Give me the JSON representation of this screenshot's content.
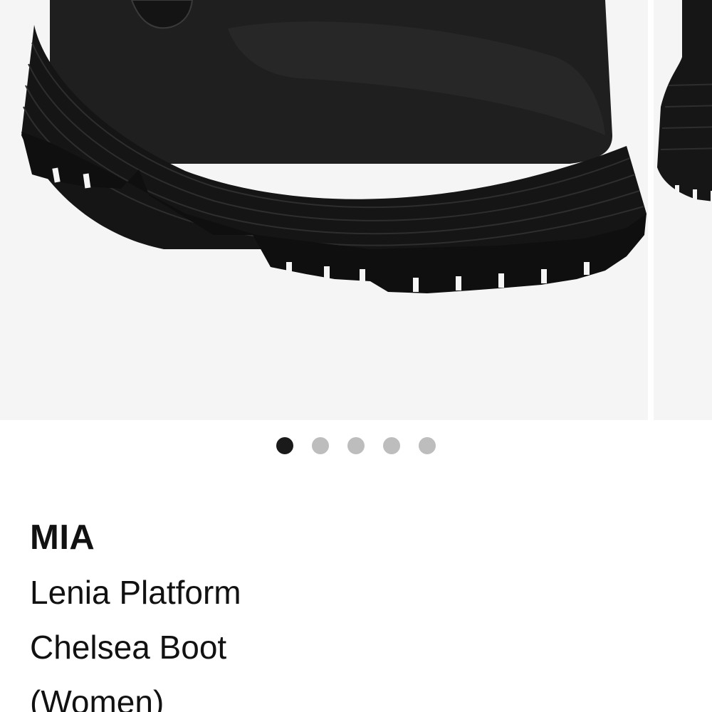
{
  "gallery": {
    "image_alt": "Black leather platform Chelsea boot",
    "slide_count": 5,
    "active_index": 0
  },
  "product": {
    "brand": "MIA",
    "name": "Lenia Platform Chelsea Boot (Women)"
  },
  "colors": {
    "image_background": "#f5f5f5",
    "dot_active": "#1a1a1a",
    "dot_inactive": "#bdbdbd",
    "text": "#111111"
  }
}
